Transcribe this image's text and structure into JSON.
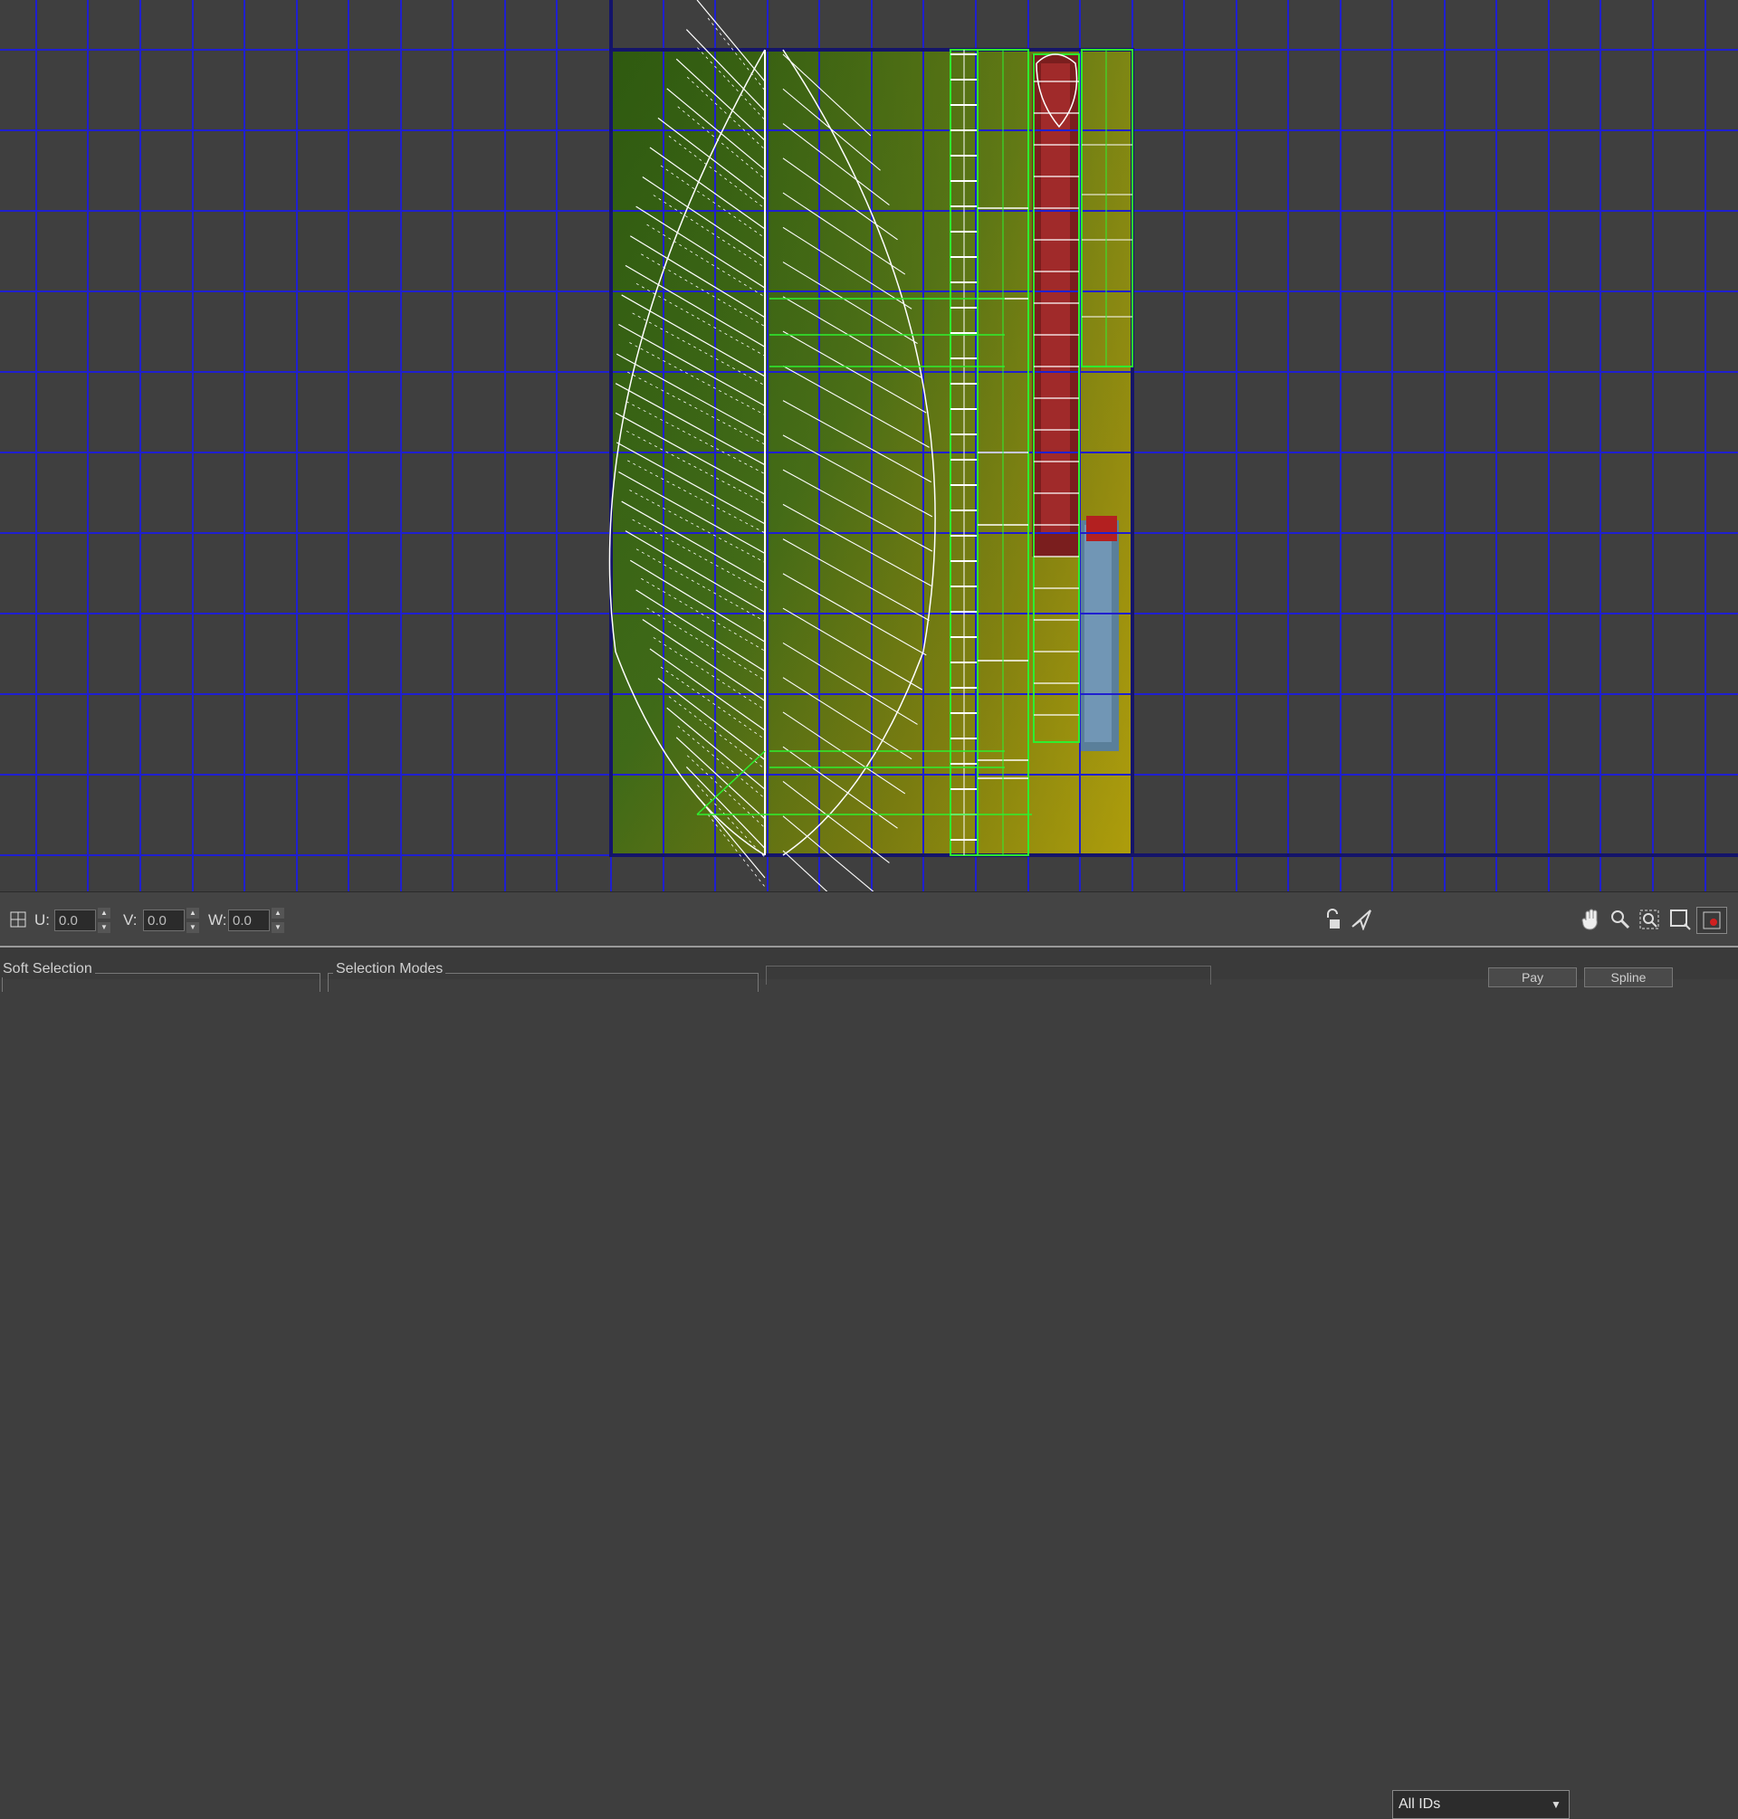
{
  "toolbar": {
    "u_label": "U:",
    "u_value": "0.0",
    "v_label": "V:",
    "v_value": "0.0",
    "w_label": "W:",
    "w_value": "0.0",
    "spin_up": "▲",
    "spin_down": "▼",
    "id_filter": "All IDs",
    "id_filter_arrow": "▼",
    "icons": {
      "lock": "lock-icon",
      "pin": "pin-icon",
      "pan": "pan-hand-icon",
      "zoom": "zoom-icon",
      "zoom_region": "zoom-region-icon",
      "zoom_extents": "zoom-extents-icon",
      "texture_toggle": "texture-toggle-icon"
    }
  },
  "bottom_panel": {
    "soft_selection_title": "Soft Selection",
    "selection_modes_title": "Selection Modes",
    "tab1": "Pay",
    "tab2": "Spline"
  },
  "colors": {
    "grid": "#1f1fd0",
    "uv_border": "#16166e",
    "wire_white": "#ffffff",
    "wire_green": "#2ef02e",
    "background": "#3f3f3f"
  }
}
